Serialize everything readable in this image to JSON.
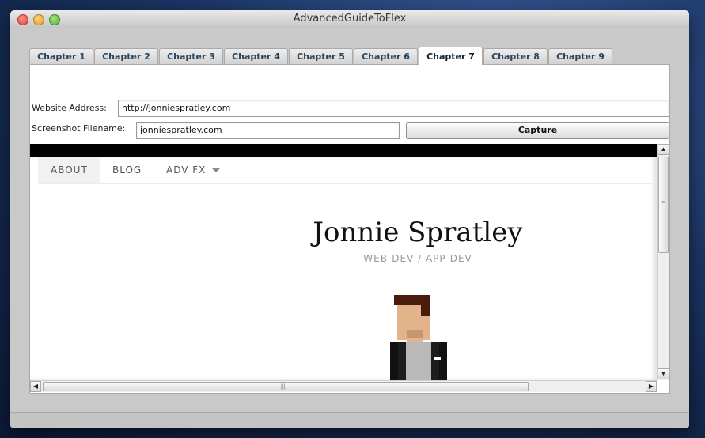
{
  "window": {
    "title": "AdvancedGuideToFlex"
  },
  "tabs": [
    {
      "label": "Chapter 1"
    },
    {
      "label": "Chapter 2"
    },
    {
      "label": "Chapter 3"
    },
    {
      "label": "Chapter 4"
    },
    {
      "label": "Chapter 5"
    },
    {
      "label": "Chapter 6"
    },
    {
      "label": "Chapter 7"
    },
    {
      "label": "Chapter 8"
    },
    {
      "label": "Chapter 9"
    }
  ],
  "active_tab": "Chapter 7",
  "form": {
    "website_label": "Website Address:",
    "website_value": "http://jonniespratley.com",
    "filename_label": "Screenshot Filename:",
    "filename_value": "jonniespratley.com",
    "capture_label": "Capture"
  },
  "webpage": {
    "nav": [
      {
        "label": "ABOUT"
      },
      {
        "label": "BLOG"
      },
      {
        "label": "ADV FX"
      }
    ],
    "site_name": "Jonnie Spratley",
    "tagline": "WEB-DEV / APP-DEV"
  },
  "icons": {
    "close": "close-icon",
    "minimize": "minimize-icon",
    "maximize": "maximize-icon",
    "dropdown": "caret-down-icon",
    "avatar": "pixel-avatar"
  }
}
